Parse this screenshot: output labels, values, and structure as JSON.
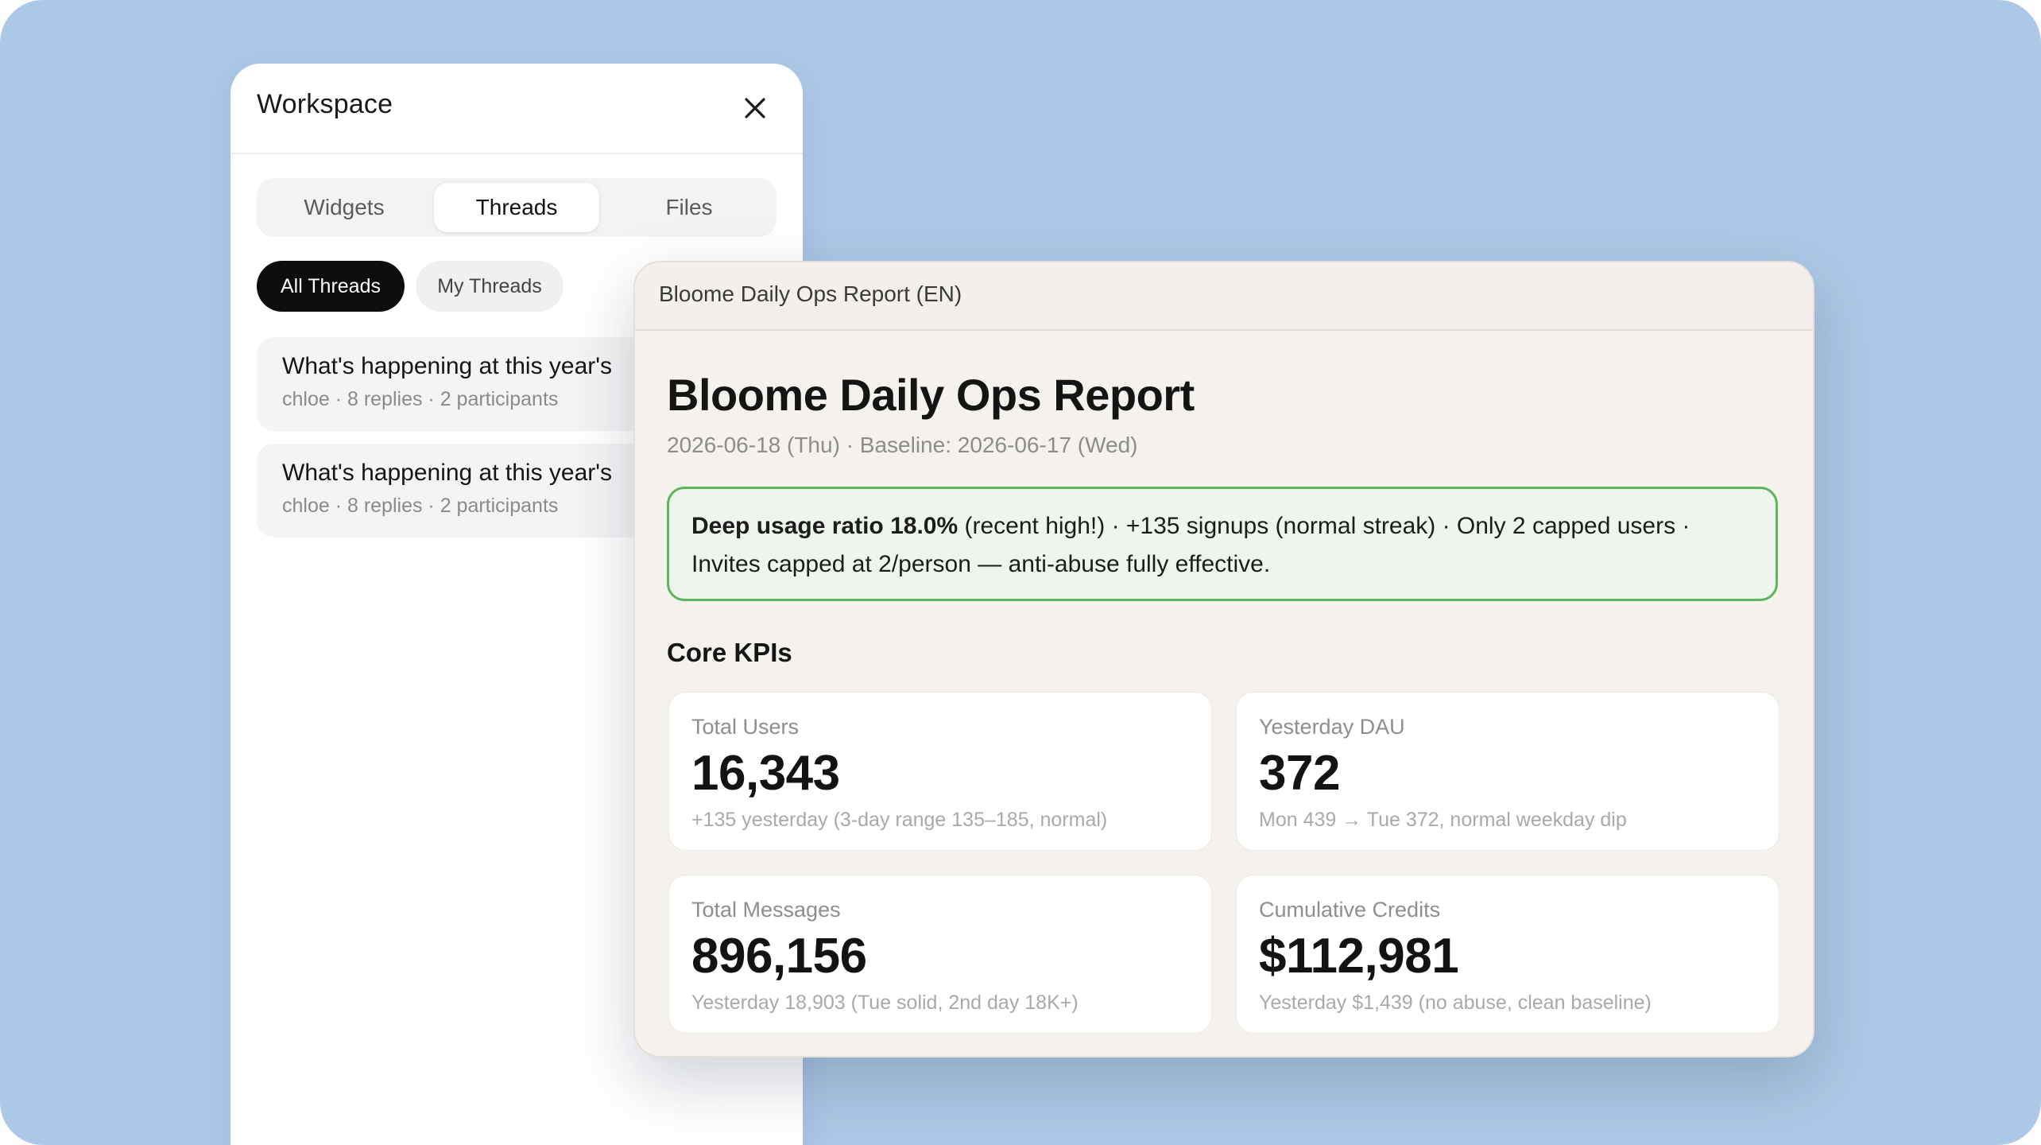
{
  "workspace": {
    "title": "Workspace",
    "tabs": [
      {
        "label": "Widgets"
      },
      {
        "label": "Threads"
      },
      {
        "label": "Files"
      }
    ],
    "active_tab": "Threads",
    "filters": [
      {
        "label": "All Threads"
      },
      {
        "label": "My Threads"
      }
    ],
    "active_filter": "All Threads",
    "threads": [
      {
        "title": "What's happening at this year's",
        "meta": "chloe · 8 replies · 2 participants"
      },
      {
        "title": "What's happening at this year's",
        "meta": "chloe · 8 replies · 2 participants"
      }
    ]
  },
  "report": {
    "window_title": "Bloome Daily Ops Report (EN)",
    "title": "Bloome Daily Ops Report",
    "date_line": "2026-06-18 (Thu) · Baseline: 2026-06-17 (Wed)",
    "highlight": {
      "bold": "Deep usage ratio 18.0%",
      "line1_rest": " (recent high!) · +135 signups (normal streak) · Only 2 capped users ·",
      "line2": "Invites capped at 2/person — anti-abuse fully effective."
    },
    "section_title": "Core KPIs",
    "kpis": [
      {
        "label": "Total Users",
        "value": "16,343",
        "note": "+135 yesterday (3-day range 135–185, normal)"
      },
      {
        "label": "Yesterday DAU",
        "value": "372",
        "note": "Mon 439 → Tue 372, normal weekday dip"
      },
      {
        "label": "Total Messages",
        "value": "896,156",
        "note": "Yesterday 18,903 (Tue solid, 2nd day 18K+)"
      },
      {
        "label": "Cumulative Credits",
        "value": "$112,981",
        "note": "Yesterday $1,439 (no abuse, clean baseline)"
      }
    ]
  },
  "colors": {
    "background": "#adc8e6",
    "highlight_border": "#5cb45e",
    "highlight_fill": "#eef5ec",
    "active_chip": "#0d0d0d"
  }
}
